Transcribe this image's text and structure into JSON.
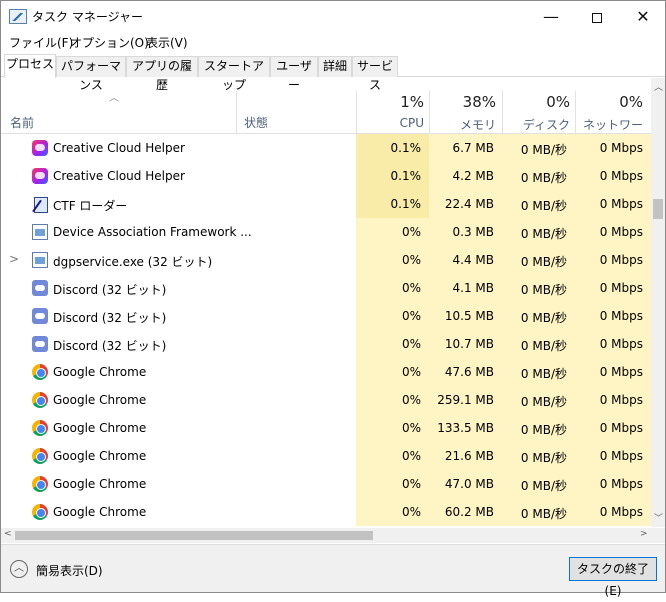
{
  "window": {
    "title": "タスク マネージャー",
    "icon": "task-manager-icon",
    "controls": {
      "minimize": "—",
      "close": "✕"
    }
  },
  "menu": [
    {
      "label": "ファイル(F)"
    },
    {
      "label": "オプション(O)"
    },
    {
      "label": "表示(V)"
    }
  ],
  "tabs": [
    {
      "label": "プロセス",
      "active": true
    },
    {
      "label": "パフォーマンス"
    },
    {
      "label": "アプリの履歴"
    },
    {
      "label": "スタートアップ"
    },
    {
      "label": "ユーザー"
    },
    {
      "label": "詳細"
    },
    {
      "label": "サービス"
    }
  ],
  "columns": {
    "name": "名前",
    "status": "状態",
    "cpu": {
      "pct": "1%",
      "label": "CPU"
    },
    "memory": {
      "pct": "38%",
      "label": "メモリ"
    },
    "disk": {
      "pct": "0%",
      "label": "ディスク"
    },
    "network": {
      "pct": "0%",
      "label": "ネットワーク"
    }
  },
  "processes": [
    {
      "name": "Creative Cloud Helper",
      "icon": "creative-cloud-icon",
      "expandable": false,
      "cpu": "0.1%",
      "memory": "6.7 MB",
      "disk": "0 MB/秒",
      "network": "0 Mbps"
    },
    {
      "name": "Creative Cloud Helper",
      "icon": "creative-cloud-icon",
      "expandable": false,
      "cpu": "0.1%",
      "memory": "4.2 MB",
      "disk": "0 MB/秒",
      "network": "0 Mbps"
    },
    {
      "name": "CTF ローダー",
      "icon": "ctf-loader-icon",
      "expandable": false,
      "cpu": "0.1%",
      "memory": "22.4 MB",
      "disk": "0 MB/秒",
      "network": "0 Mbps"
    },
    {
      "name": "Device Association Framework ...",
      "icon": "window-app-icon",
      "expandable": false,
      "cpu": "0%",
      "memory": "0.3 MB",
      "disk": "0 MB/秒",
      "network": "0 Mbps"
    },
    {
      "name": "dgpservice.exe (32 ビット)",
      "icon": "window-app-icon",
      "expandable": true,
      "cpu": "0%",
      "memory": "4.4 MB",
      "disk": "0 MB/秒",
      "network": "0 Mbps"
    },
    {
      "name": "Discord (32 ビット)",
      "icon": "discord-icon",
      "expandable": false,
      "cpu": "0%",
      "memory": "4.1 MB",
      "disk": "0 MB/秒",
      "network": "0 Mbps"
    },
    {
      "name": "Discord (32 ビット)",
      "icon": "discord-icon",
      "expandable": false,
      "cpu": "0%",
      "memory": "10.5 MB",
      "disk": "0 MB/秒",
      "network": "0 Mbps"
    },
    {
      "name": "Discord (32 ビット)",
      "icon": "discord-icon",
      "expandable": false,
      "cpu": "0%",
      "memory": "10.7 MB",
      "disk": "0 MB/秒",
      "network": "0 Mbps"
    },
    {
      "name": "Google Chrome",
      "icon": "chrome-icon",
      "expandable": false,
      "cpu": "0%",
      "memory": "47.6 MB",
      "disk": "0 MB/秒",
      "network": "0 Mbps"
    },
    {
      "name": "Google Chrome",
      "icon": "chrome-icon",
      "expandable": false,
      "cpu": "0%",
      "memory": "259.1 MB",
      "disk": "0 MB/秒",
      "network": "0 Mbps"
    },
    {
      "name": "Google Chrome",
      "icon": "chrome-icon",
      "expandable": false,
      "cpu": "0%",
      "memory": "133.5 MB",
      "disk": "0 MB/秒",
      "network": "0 Mbps"
    },
    {
      "name": "Google Chrome",
      "icon": "chrome-icon",
      "expandable": false,
      "cpu": "0%",
      "memory": "21.6 MB",
      "disk": "0 MB/秒",
      "network": "0 Mbps"
    },
    {
      "name": "Google Chrome",
      "icon": "chrome-icon",
      "expandable": false,
      "cpu": "0%",
      "memory": "47.0 MB",
      "disk": "0 MB/秒",
      "network": "0 Mbps"
    },
    {
      "name": "Google Chrome",
      "icon": "chrome-icon",
      "expandable": false,
      "cpu": "0%",
      "memory": "60.2 MB",
      "disk": "0 MB/秒",
      "network": "0 Mbps"
    }
  ],
  "footer": {
    "fewer_details": "簡易表示(D)",
    "end_task": "タスクの終了(E)"
  },
  "colors": {
    "heat_light": "#fff4c4",
    "heat_medium": "#f9eca8",
    "header_text": "#4c607a",
    "focus_outline": "#0078d7"
  }
}
